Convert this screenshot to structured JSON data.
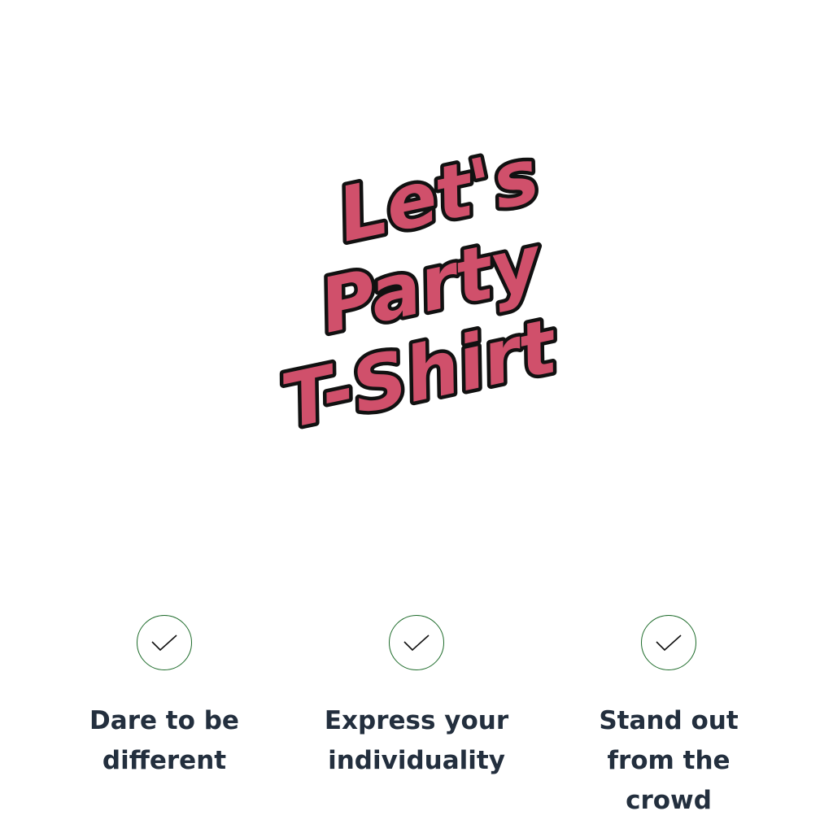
{
  "design": {
    "line1": "Let's",
    "line2": "Party",
    "line3": "T-Shirt",
    "fill_color": "#d0506b",
    "outline_color": "#111111"
  },
  "features": [
    {
      "icon": "check-icon",
      "label": "Dare to be different"
    },
    {
      "icon": "check-icon",
      "label": "Express your individuality"
    },
    {
      "icon": "check-icon",
      "label": "Stand out from the crowd"
    }
  ],
  "colors": {
    "background": "#ffffff",
    "check_color": "#1d6b2a",
    "text_color": "#232f3e"
  }
}
